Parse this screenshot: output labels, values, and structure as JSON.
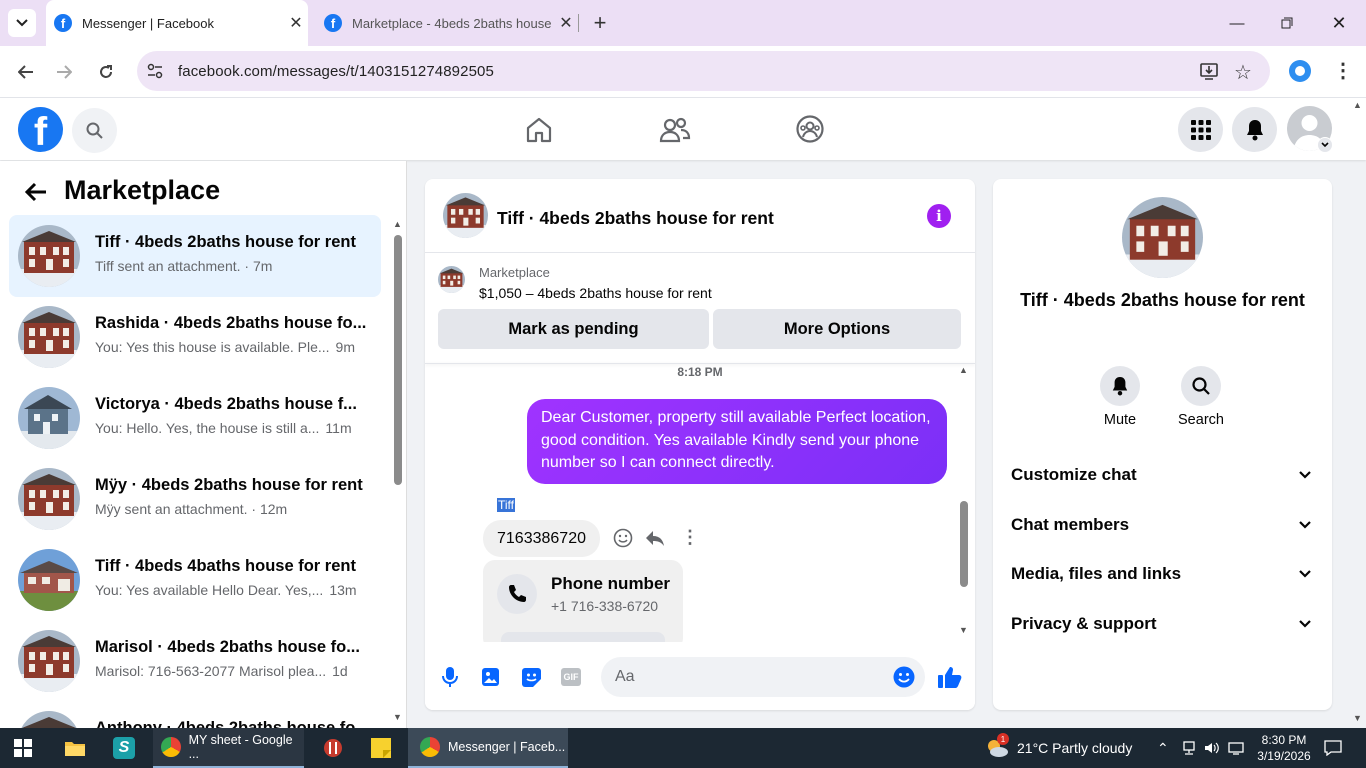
{
  "browser": {
    "tabs": [
      {
        "title": "Messenger | Facebook",
        "active": true
      },
      {
        "title": "Marketplace - 4beds 2baths house",
        "active": false
      }
    ],
    "url": "facebook.com/messages/t/1403151274892505"
  },
  "left": {
    "heading": "Marketplace",
    "conversations": [
      {
        "name": "Tiff · 4beds 2baths house for rent",
        "preview": "Tiff sent an attachment. · 7m",
        "selected": true
      },
      {
        "name": "Rashida · 4beds 2baths house fo...",
        "preview": "You: Yes this house is available. Ple...",
        "time": "9m"
      },
      {
        "name": "Victorya · 4beds 2baths house f...",
        "preview": "You: Hello. Yes, the house is still a...",
        "time": "11m"
      },
      {
        "name": "Mÿy · 4beds 2baths house for rent",
        "preview": "Mÿy sent an attachment. · 12m"
      },
      {
        "name": "Tiff · 4beds 4baths house for rent",
        "preview": "You: Yes available Hello Dear. Yes,...",
        "time": "13m"
      },
      {
        "name": "Marisol · 4beds 2baths house fo...",
        "preview": "Marisol: 716-563-2077 Marisol plea...",
        "time": "1d"
      },
      {
        "name": "Anthony · 4beds 2baths house fo...",
        "preview": ""
      }
    ]
  },
  "chat": {
    "title": "Tiff · 4beds 2baths house for rent",
    "listing_label": "Marketplace",
    "listing_text": "$1,050 – 4beds 2baths house for rent",
    "mark_pending": "Mark as pending",
    "more_options": "More Options",
    "timestamp": "8:18 PM",
    "outgoing_message": "Dear Customer, property still available  Perfect location, good condition. Yes available Kindly send your phone number so I can connect directly.",
    "sender_name": "Tiff",
    "incoming_message": "7163386720",
    "phone_card_title": "Phone number",
    "phone_card_number": "+1 716-338-6720",
    "composer_placeholder": "Aa"
  },
  "right": {
    "title": "Tiff · 4beds 2baths house for rent",
    "mute": "Mute",
    "search": "Search",
    "menu": [
      "Customize chat",
      "Chat members",
      "Media, files and links",
      "Privacy & support"
    ]
  },
  "taskbar": {
    "items": [
      "MY sheet - Google ...",
      "Messenger | Faceb..."
    ],
    "weather": "21°C  Partly cloudy",
    "time": "8:30 PM",
    "date": "3/19/2026",
    "notification_badge": "1"
  },
  "colors": {
    "accent": "#0866ff",
    "bubble": "#8a2be2",
    "fb_blue": "#1877f2"
  }
}
